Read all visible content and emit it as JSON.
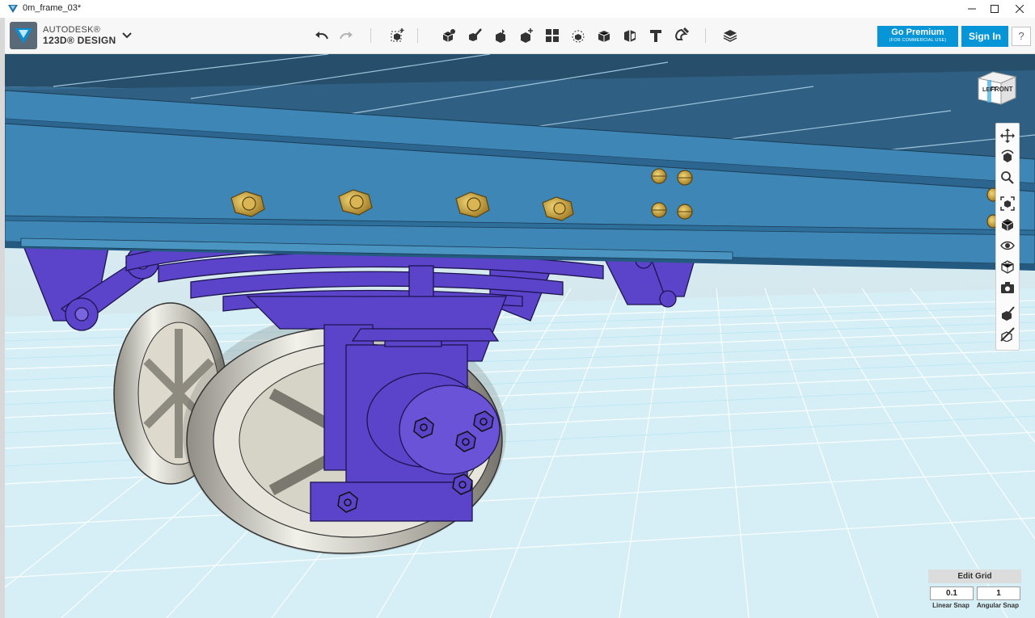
{
  "window": {
    "title": "0m_frame_03*"
  },
  "brand": {
    "line1": "AUTODESK®",
    "line2": "123D® DESIGN"
  },
  "toolbar": {
    "undo_icon": "undo-icon",
    "redo_icon": "redo-icon",
    "tools": [
      "transform-icon",
      "primitives-icon",
      "sketch-icon",
      "construct-icon",
      "modify-icon",
      "pattern-icon",
      "grouping-icon",
      "combine-icon",
      "measure-icon",
      "text-icon",
      "snap-icon",
      "material-icon"
    ]
  },
  "premium": {
    "label": "Go Premium",
    "sub": "(FOR COMMERCIAL USE)"
  },
  "signin": {
    "label": "Sign In"
  },
  "help": {
    "label": "?"
  },
  "navcube": {
    "left_face": "LEFT",
    "front_face": "FRONT"
  },
  "grid": {
    "edit_label": "Edit Grid",
    "linear_value": "0.1",
    "angular_value": "1",
    "linear_label": "Linear Snap",
    "angular_label": "Angular Snap"
  },
  "colors": {
    "accent": "#0696d7",
    "frame_blue": "#3d86b5",
    "suspension_purple": "#5b44c9",
    "bolt_gold": "#c9a23a",
    "wheel_silver": "#c8c6bb",
    "grid_cyan": "#8fd7ec"
  }
}
